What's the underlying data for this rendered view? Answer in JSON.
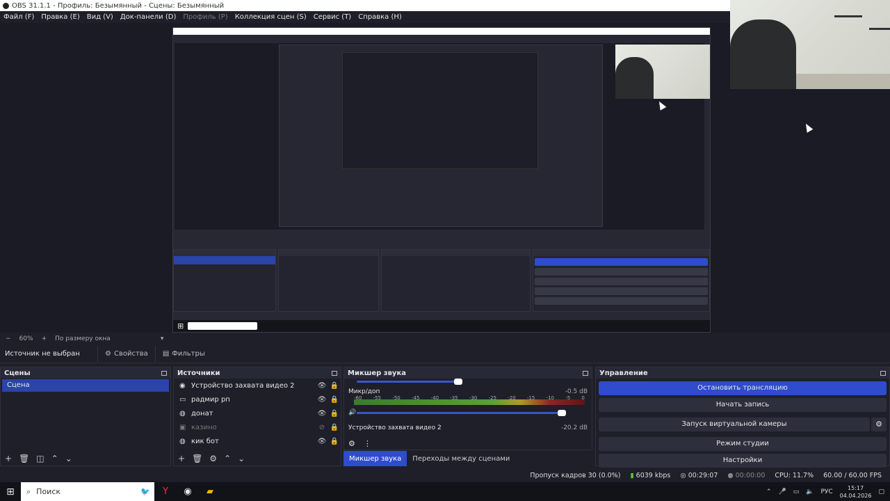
{
  "window": {
    "title": "OBS 31.1.1 - Профиль: Безымянный - Сцены: Безымянный"
  },
  "menu": {
    "file": "Файл (F)",
    "edit": "Правка (E)",
    "view": "Вид (V)",
    "docks": "Док-панели (D)",
    "profile": "Профиль (P)",
    "scenes": "Коллекция сцен (S)",
    "tools": "Сервис (T)",
    "help": "Справка (H)"
  },
  "zoombar": {
    "minus": "−",
    "zoom": "60%",
    "plus": "+",
    "fit": "По размеру окна",
    "arrow": "▾"
  },
  "context": {
    "no_source": "Источник не выбран",
    "properties": "Свойства",
    "filters": "Фильтры"
  },
  "scenes": {
    "title": "Сцены",
    "items": [
      "Сцена"
    ]
  },
  "sources": {
    "title": "Источники",
    "items": [
      {
        "label": "Устройство захвата видео 2",
        "icon": "camera-icon"
      },
      {
        "label": "радмир рп",
        "icon": "window-icon"
      },
      {
        "label": "донат",
        "icon": "globe-icon"
      },
      {
        "label": "казино",
        "icon": "image-icon"
      },
      {
        "label": "кик бот",
        "icon": "globe-icon"
      }
    ]
  },
  "mixer": {
    "title": "Микшер звука",
    "channel1_name": "Микр/доп",
    "channel1_db": "-0.5 dB",
    "channel1_level": 0.97,
    "ticks": [
      "-60",
      "-55",
      "-50",
      "-45",
      "-40",
      "-35",
      "-30",
      "-25",
      "-20",
      "-15",
      "-10",
      "-5",
      "0"
    ],
    "channel2_name": "Устройство захвата видео 2",
    "channel2_db": "-20.2 dB",
    "tab_mixer": "Микшер звука",
    "tab_transitions": "Переходы между сценами"
  },
  "controls": {
    "title": "Управление",
    "stop_stream": "Остановить трансляцию",
    "start_record": "Начать запись",
    "virtual_cam": "Запуск виртуальной камеры",
    "studio_mode": "Режим студии",
    "settings": "Настройки"
  },
  "status": {
    "dropped": "Пропуск кадров 30 (0.0%)",
    "bitrate": "6039 kbps",
    "stream_time": "00:29:07",
    "record_time": "00:00:00",
    "cpu": "CPU: 11.7%",
    "fps": "60.00 / 60.00 FPS"
  },
  "taskbar": {
    "search_placeholder": "Поиск",
    "lang": "РУС",
    "time": "15:17",
    "date": "04.04.2026"
  },
  "colors": {
    "accent": "#2f4ccc",
    "selection": "#2a44a8",
    "background": "#1e1f29"
  }
}
